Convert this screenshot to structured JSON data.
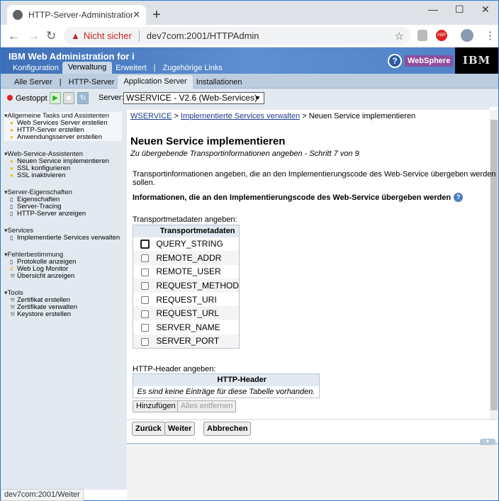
{
  "browser": {
    "tab_title": "HTTP-Server-Administration auf IBM",
    "security": "Nicht sicher",
    "url": "dev7com:2001/HTTPAdmin",
    "status_url": "dev7com:2001/Weiter"
  },
  "header": {
    "title": "IBM Web Administration for i",
    "help": "?",
    "websphere": "WebSphere",
    "ibm": "IBM",
    "main_tabs": [
      "Konfiguration",
      "Verwaltung",
      "Erweitert",
      "|",
      "Zugehörige Links"
    ],
    "sub_tabs": [
      "Alle Server",
      "|",
      "HTTP-Server",
      "Application Server",
      "Installationen"
    ]
  },
  "server_bar": {
    "status": "Gestoppt",
    "server_label": "Server:",
    "server_value": "WSERVICE - V2.6 (Web-Services)"
  },
  "sidebar": [
    {
      "title": "Allgemeine Tasks und Assistenten",
      "items": [
        "Web Services Server erstellen",
        "HTTP-Server erstellen",
        "Anwendungsserver erstellen"
      ]
    },
    {
      "title": "Web-Service-Assistenten",
      "items": [
        "Neuen Service implementieren",
        "SSL konfigurieren",
        "SSL inaktivieren"
      ]
    },
    {
      "title": "Server-Eigenschaften",
      "items": [
        "Eigenschaften",
        "Server-Tracing",
        "HTTP-Server anzeigen"
      ]
    },
    {
      "title": "Services",
      "items": [
        "Implementierte Services verwalten"
      ]
    },
    {
      "title": "Fehlerbestimmung",
      "items": [
        "Protokolle anzeigen",
        "Web Log Monitor",
        "Übersicht anzeigen"
      ]
    },
    {
      "title": "Tools",
      "items": [
        "Zertifikat erstellen",
        "Zertifikate verwalten",
        "Keystore erstellen"
      ]
    }
  ],
  "breadcrumb": {
    "c1": "WSERVICE",
    "sep": " > ",
    "c2": "Implementierte Services verwalten",
    "c3": "Neuen Service implementieren"
  },
  "page": {
    "title": "Neuen Service implementieren",
    "subtitle": "Zu übergebende Transportinformationen angeben - Schritt 7 von 9",
    "desc": "Transportinformationen angeben, die an den Implementierungscode des Web-Service übergeben werden sollen.",
    "section": "Informationen, die an den Implementierungscode des Web-Service übergeben werden",
    "tm_label": "Transportmetadaten angeben:",
    "tm_header": "Transportmetadaten",
    "tm_rows": [
      "QUERY_STRING",
      "REMOTE_ADDR",
      "REMOTE_USER",
      "REQUEST_METHOD",
      "REQUEST_URI",
      "REQUEST_URL",
      "SERVER_NAME",
      "SERVER_PORT"
    ],
    "hh_label": "HTTP-Header angeben:",
    "hh_header": "HTTP-Header",
    "hh_empty": "Es sind keine Einträge für diese Tabelle vorhanden.",
    "add": "Hinzufügen",
    "remove_all": "Alles entfernen"
  },
  "buttons": {
    "back": "Zurück",
    "next": "Weiter",
    "cancel": "Abbrechen"
  }
}
